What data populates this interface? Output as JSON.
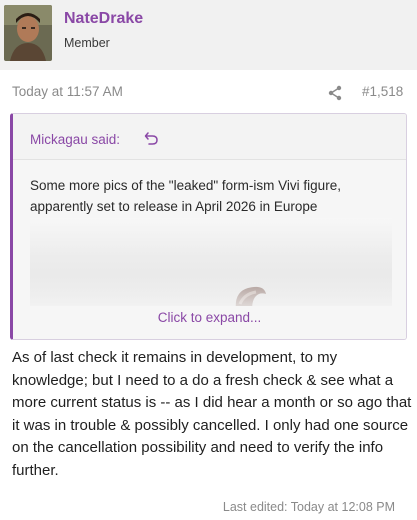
{
  "user": {
    "name": "NateDrake",
    "title": "Member"
  },
  "post": {
    "date": "Today at 11:57 AM",
    "number": "#1,518",
    "body": "As of last check it remains in development, to my knowledge; but I need to a do a fresh check & see what a more current status is -- as I did hear a month or so ago that it was in trouble & possibly cancelled. I only had one source on the cancellation possibility and need to verify the info further.",
    "last_edited": "Last edited: Today at 12:08 PM"
  },
  "quote": {
    "author": "Mickagau said:",
    "text": "Some more pics of the \"leaked\" form-ism Vivi figure, apparently set to release in April 2026 in Europe",
    "expand_label": "Click to expand..."
  },
  "colors": {
    "accent": "#8a48a6",
    "muted_text": "#8a8a8a",
    "header_bg": "#f1f1f1"
  },
  "icons": {
    "share": "share-icon",
    "quote_jump": "arrow-back-icon"
  }
}
